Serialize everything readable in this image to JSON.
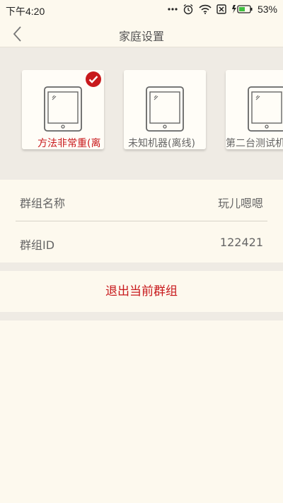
{
  "status_bar": {
    "time": "下午4:20",
    "battery_percent": "53%",
    "battery_level": 0.53
  },
  "nav": {
    "title": "家庭设置"
  },
  "devices": [
    {
      "name": "方法非常重(离",
      "selected": true
    },
    {
      "name": "未知机器(离线)",
      "selected": false
    },
    {
      "name": "第二台测试机",
      "selected": false
    }
  ],
  "group_info": {
    "name_label": "群组名称",
    "name_value": "玩儿嗯嗯",
    "id_label": "群组ID",
    "id_value": "122421"
  },
  "actions": {
    "leave_group": "退出当前群组"
  },
  "colors": {
    "accent_red": "#c8191c",
    "background": "#fdf9ee",
    "section_gray": "#efebe4"
  }
}
